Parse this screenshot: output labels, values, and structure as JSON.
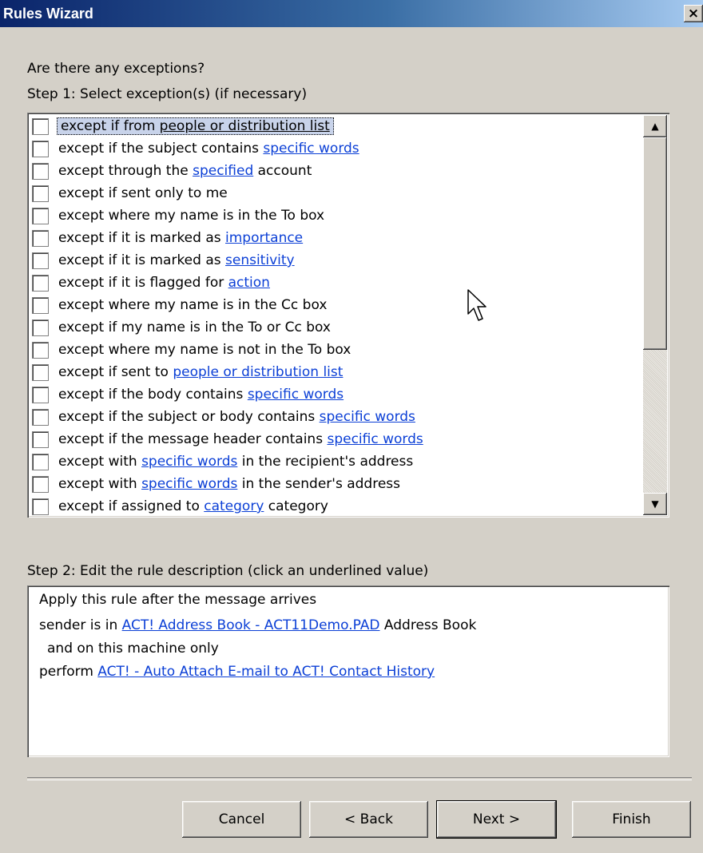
{
  "window": {
    "title": "Rules Wizard",
    "close_glyph": "×"
  },
  "question": "Are there any exceptions?",
  "step1_label": "Step 1: Select exception(s) (if necessary)",
  "exceptions": [
    {
      "before": "except if from ",
      "link": "people or distribution list",
      "after": "",
      "link_style": "plain",
      "selected": true
    },
    {
      "before": "except if the subject contains ",
      "link": "specific words",
      "after": ""
    },
    {
      "before": "except through the ",
      "link": "specified",
      "after": " account"
    },
    {
      "before": "except if sent only to me",
      "link": "",
      "after": ""
    },
    {
      "before": "except where my name is in the To box",
      "link": "",
      "after": ""
    },
    {
      "before": "except if it is marked as ",
      "link": "importance",
      "after": ""
    },
    {
      "before": "except if it is marked as ",
      "link": "sensitivity",
      "after": ""
    },
    {
      "before": "except if it is flagged for ",
      "link": "action",
      "after": ""
    },
    {
      "before": "except where my name is in the Cc box",
      "link": "",
      "after": ""
    },
    {
      "before": "except if my name is in the To or Cc box",
      "link": "",
      "after": ""
    },
    {
      "before": "except where my name is not in the To box",
      "link": "",
      "after": ""
    },
    {
      "before": "except if sent to ",
      "link": "people or distribution list",
      "after": ""
    },
    {
      "before": "except if the body contains ",
      "link": "specific words",
      "after": ""
    },
    {
      "before": "except if the subject or body contains ",
      "link": "specific words",
      "after": ""
    },
    {
      "before": "except if the message header contains ",
      "link": "specific words",
      "after": ""
    },
    {
      "before": "except with ",
      "link": "specific words",
      "after": " in the recipient's address"
    },
    {
      "before": "except with ",
      "link": "specific words",
      "after": " in the sender's address"
    },
    {
      "before": "except if assigned to ",
      "link": "category",
      "after": " category"
    }
  ],
  "scrollbar": {
    "up_glyph": "▲",
    "down_glyph": "▼"
  },
  "step2_label": "Step 2: Edit the rule description (click an underlined value)",
  "description": {
    "line1": "Apply this rule after the message arrives",
    "line2_before": "sender is in ",
    "line2_link": "ACT! Address Book - ACT11Demo.PAD",
    "line2_after": " Address Book",
    "line3": "and on this machine only",
    "line4_before": "perform ",
    "line4_link": "ACT! - Auto Attach E-mail to ACT! Contact History"
  },
  "buttons": {
    "cancel": "Cancel",
    "back": "< Back",
    "next": "Next >",
    "finish": "Finish"
  },
  "colors": {
    "link": "#0b3fd6",
    "title_start": "#0a246a",
    "title_end": "#a6caf0",
    "face": "#d4d0c8"
  }
}
